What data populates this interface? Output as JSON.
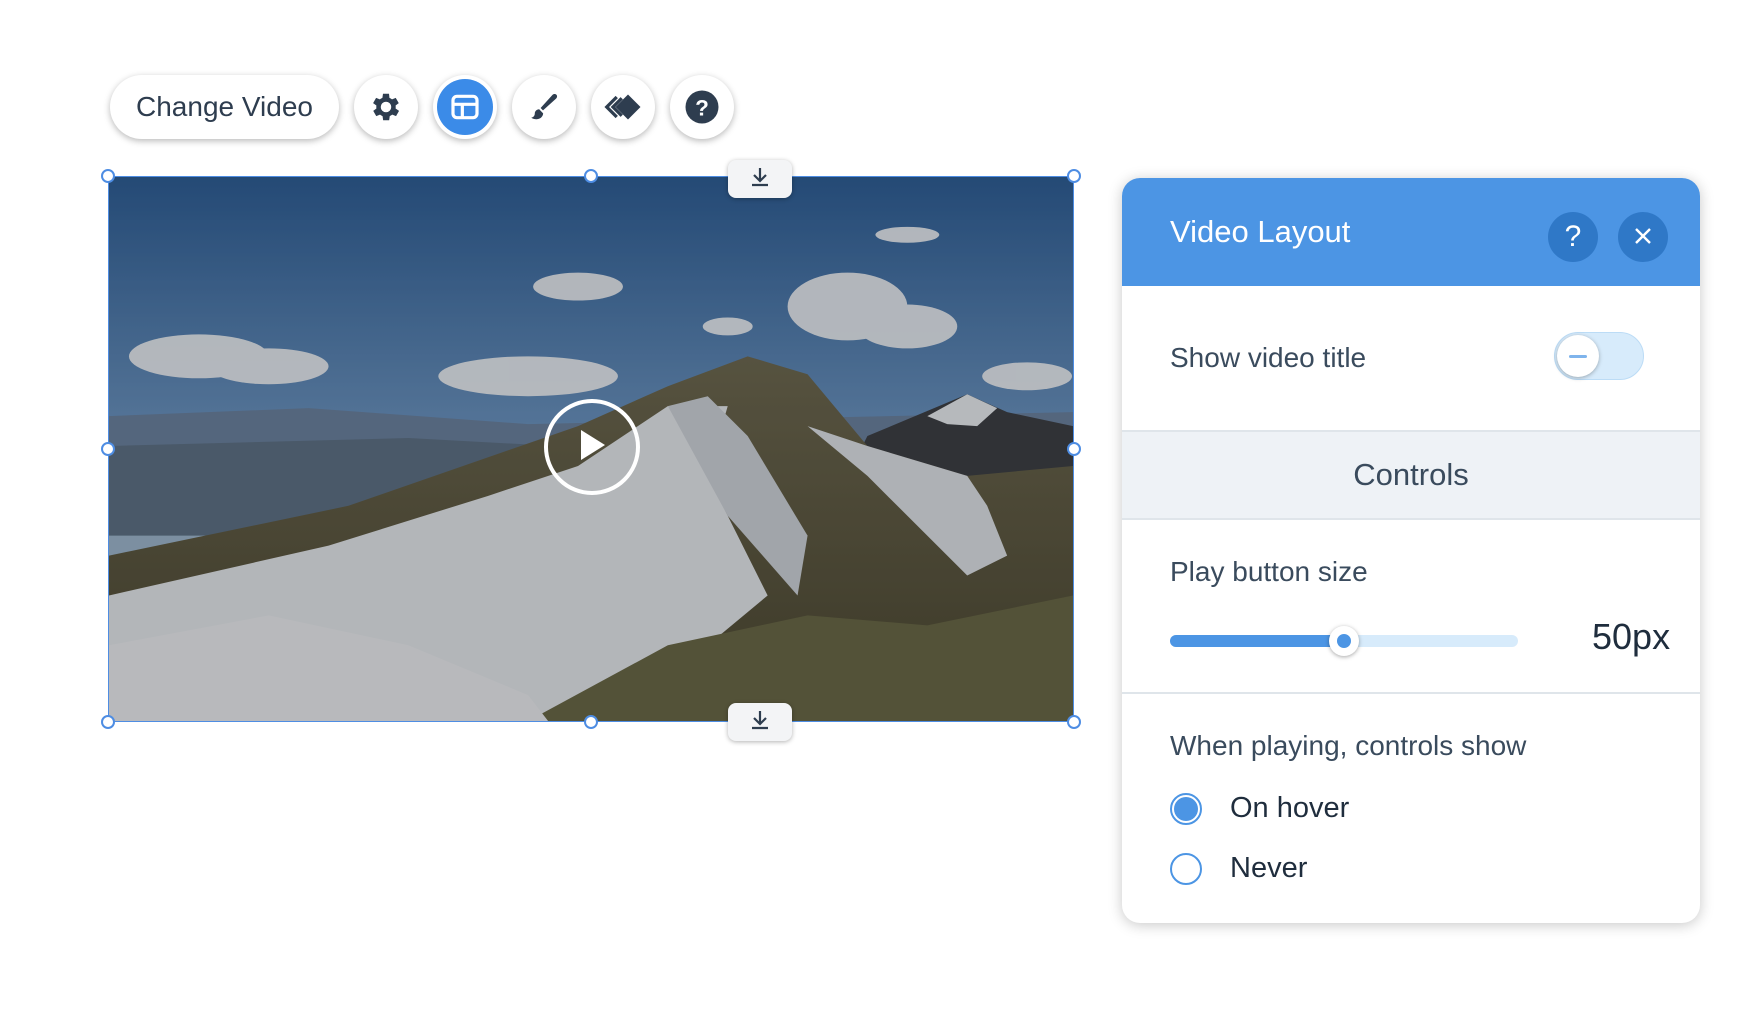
{
  "toolbar": {
    "change_video_label": "Change Video",
    "icons": [
      "gear-icon",
      "layout-icon",
      "brush-icon",
      "animation-icon",
      "help-icon"
    ],
    "active_tool": "layout-icon"
  },
  "panel": {
    "title": "Video Layout",
    "help_glyph": "?",
    "show_title_label": "Show video title",
    "show_title_enabled": false,
    "controls_section_label": "Controls",
    "play_size_label": "Play button size",
    "play_size_value": "50px",
    "play_size_fraction": 0.5,
    "controls_show_label": "When playing, controls show",
    "options": [
      {
        "label": "On hover",
        "selected": true
      },
      {
        "label": "Never",
        "selected": false
      }
    ]
  },
  "colors": {
    "accent": "#4c95e4",
    "accent_dark": "#2f78c7",
    "selection": "#4e8de3"
  }
}
